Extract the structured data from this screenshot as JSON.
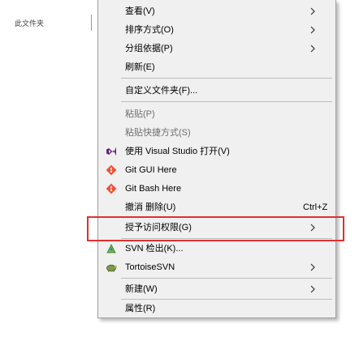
{
  "background": {
    "label": "此文件夹"
  },
  "menu": {
    "items": [
      {
        "label": "查看(V)",
        "submenu": true
      },
      {
        "label": "排序方式(O)",
        "submenu": true
      },
      {
        "label": "分组依据(P)",
        "submenu": true
      },
      {
        "label": "刷新(E)"
      },
      {
        "label": "自定义文件夹(F)..."
      },
      {
        "label": "粘贴(P)"
      },
      {
        "label": "粘贴快捷方式(S)"
      },
      {
        "label": "使用 Visual Studio 打开(V)",
        "icon": "visual-studio-icon"
      },
      {
        "label": "Git GUI Here",
        "icon": "git-gui-icon"
      },
      {
        "label": "Git Bash Here",
        "icon": "git-bash-icon"
      },
      {
        "label": "撤消 删除(U)",
        "shortcut": "Ctrl+Z"
      },
      {
        "label": "授予访问权限(G)",
        "submenu": true
      },
      {
        "label": "SVN 检出(K)...",
        "icon": "svn-checkout-icon"
      },
      {
        "label": "TortoiseSVN",
        "icon": "tortoisesvn-icon",
        "submenu": true
      },
      {
        "label": "新建(W)",
        "submenu": true
      },
      {
        "label": "属性(R)"
      }
    ]
  },
  "colors": {
    "highlight_border": "#e03030",
    "menu_bg": "#f0f0f0",
    "vs_purple": "#68217a",
    "git_orange": "#f05133"
  }
}
